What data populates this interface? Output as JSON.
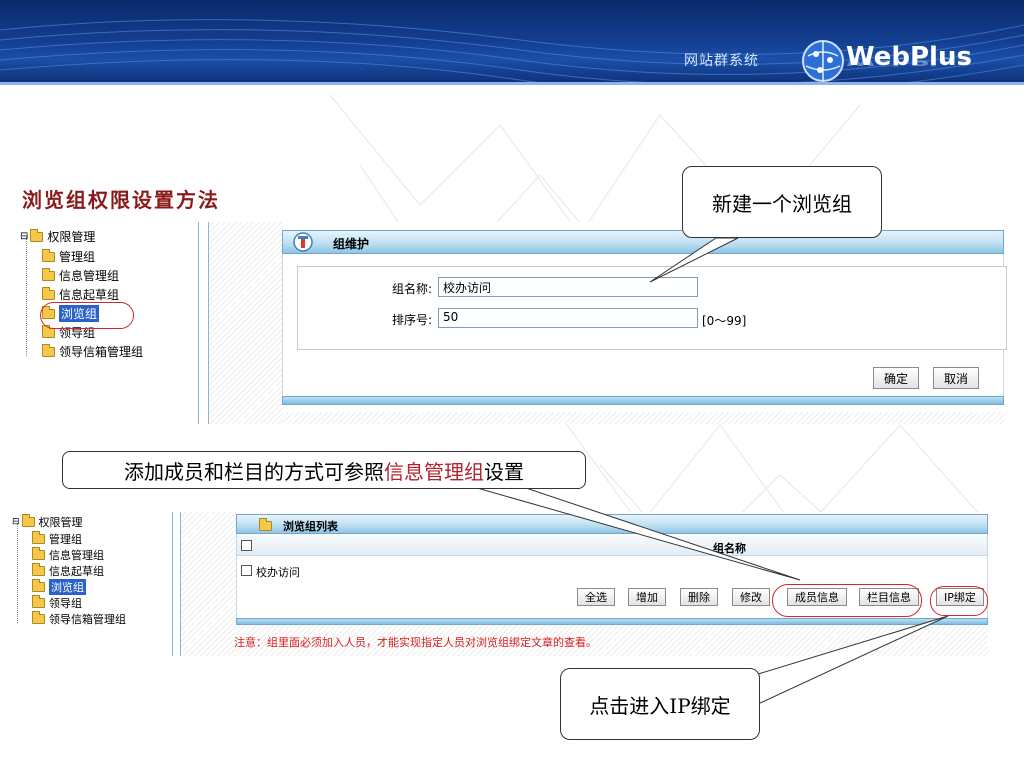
{
  "header": {
    "subtitle": "网站群系统",
    "logo": "WebPlus",
    "colors": {
      "banner": "#123c8c",
      "accent": "#8b1b1b",
      "highlight": "#d62828"
    }
  },
  "slide": {
    "title": "浏览组权限设置方法"
  },
  "shot1": {
    "tree": {
      "root": "权限管理",
      "items": [
        "管理组",
        "信息管理组",
        "信息起草组",
        "浏览组",
        "领导组",
        "领导信箱管理组"
      ],
      "selected": "浏览组"
    },
    "panel_title": "组维护",
    "form": {
      "name_label": "组名称:",
      "name_value": "校办访问",
      "order_label": "排序号:",
      "order_value": "50",
      "order_range": "[0～99]"
    },
    "buttons": {
      "ok": "确定",
      "cancel": "取消"
    }
  },
  "shot2": {
    "tree": {
      "root": "权限管理",
      "items": [
        "管理组",
        "信息管理组",
        "信息起草组",
        "浏览组",
        "领导组",
        "领导信箱管理组"
      ],
      "selected": "浏览组"
    },
    "panel_title": "浏览组列表",
    "column_header": "组名称",
    "rows": [
      "校办访问"
    ],
    "buttons": {
      "select_all": "全选",
      "add": "增加",
      "delete": "删除",
      "edit": "修改",
      "member_info": "成员信息",
      "column_info": "栏目信息",
      "ip_bind": "IP绑定"
    },
    "note": "注意：组里面必须加入人员，才能实现指定人员对浏览组绑定文章的查看。"
  },
  "callouts": {
    "new_group": "新建一个浏览组",
    "add_members_pre": "添加成员和栏目的方式可参照",
    "add_members_hl": "信息管理组",
    "add_members_post": "设置",
    "ip_bind": "点击进入IP绑定"
  }
}
